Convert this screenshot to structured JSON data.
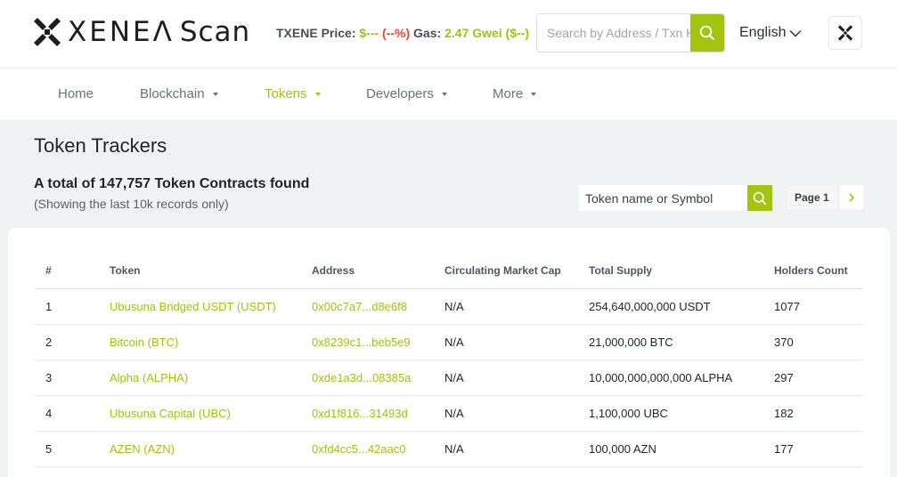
{
  "brand": {
    "logo_text_main": "XENEΛ",
    "logo_text_sub": "Scan"
  },
  "header": {
    "price_label": "TXENE Price:",
    "price_value": "$---",
    "price_change": "(--%)",
    "gas_label": "Gas:",
    "gas_value": "2.47 Gwei ($--)",
    "search_placeholder": "Search by Address / Txn Hash / Block / Token",
    "language": "English"
  },
  "nav": {
    "items": [
      {
        "label": "Home",
        "dropdown": false,
        "active": false
      },
      {
        "label": "Blockchain",
        "dropdown": true,
        "active": false
      },
      {
        "label": "Tokens",
        "dropdown": true,
        "active": true
      },
      {
        "label": "Developers",
        "dropdown": true,
        "active": false
      },
      {
        "label": "More",
        "dropdown": true,
        "active": false
      }
    ]
  },
  "page": {
    "title": "Token Trackers",
    "total_text": "A total of 147,757 Token Contracts found",
    "sub_text": "(Showing the last 10k records only)",
    "token_search_placeholder": "Token name or Symbol",
    "page_label": "Page 1"
  },
  "table": {
    "headers": [
      "#",
      "Token",
      "Address",
      "Circulating Market Cap",
      "Total Supply",
      "Holders Count"
    ],
    "rows": [
      {
        "rank": "1",
        "token": "Ubusuna Bridged USDT (USDT)",
        "address": "0x00c7a7...d8e6f8",
        "market_cap": "N/A",
        "supply": "254,640,000,000 USDT",
        "holders": "1077"
      },
      {
        "rank": "2",
        "token": "Bitcoin (BTC)",
        "address": "0x8239c1...beb5e9",
        "market_cap": "N/A",
        "supply": "21,000,000 BTC",
        "holders": "370"
      },
      {
        "rank": "3",
        "token": "Alpha (ALPHA)",
        "address": "0xde1a3d...08385a",
        "market_cap": "N/A",
        "supply": "10,000,000,000,000 ALPHA",
        "holders": "297"
      },
      {
        "rank": "4",
        "token": "Ubusuna Capital (UBC)",
        "address": "0xd1f816...31493d",
        "market_cap": "N/A",
        "supply": "1,100,000 UBC",
        "holders": "182"
      },
      {
        "rank": "5",
        "token": "AZEN (AZN)",
        "address": "0xfd4cc5...42aac0",
        "market_cap": "N/A",
        "supply": "100,000 AZN",
        "holders": "177"
      }
    ]
  },
  "colors": {
    "accent": "#a3c50f",
    "negative": "#e8492f",
    "background": "#f1f2f4"
  }
}
